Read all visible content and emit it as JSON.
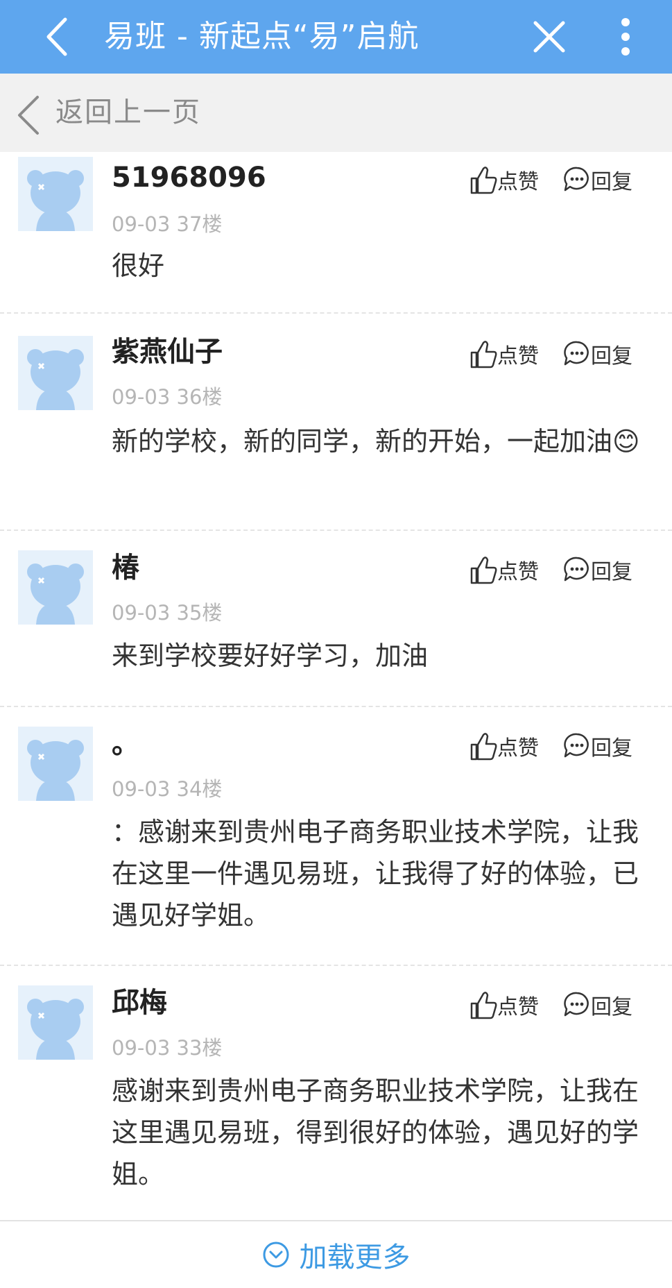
{
  "header": {
    "title": "易班 - 新起点“易”启航",
    "color": "#5ea6ee"
  },
  "subbar": {
    "back_label": "返回上一页"
  },
  "actions": {
    "like_label": "点赞",
    "reply_label": "回复"
  },
  "comments": [
    {
      "name": "51968096",
      "date": "09-03",
      "floor": "37楼",
      "content": "很好"
    },
    {
      "name": "紫燕仙子",
      "date": "09-03",
      "floor": "36楼",
      "content": "新的学校，新的同学，新的开始，一起加油😊"
    },
    {
      "name": "椿",
      "date": "09-03",
      "floor": "35楼",
      "content": "来到学校要好好学习，加油"
    },
    {
      "name": "。",
      "date": "09-03",
      "floor": "34楼",
      "content": "：感谢来到贵州电子商务职业技术学院，让我在这里一件遇见易班，让我得了好的体验，已遇见好学姐。"
    },
    {
      "name": "邱梅",
      "date": "09-03",
      "floor": "33楼",
      "content": "感谢来到贵州电子商务职业技术学院，让我在这里遇见易班，得到很好的体验，遇见好的学姐。"
    }
  ],
  "footer": {
    "load_more_label": "加载更多",
    "accent": "#3d9ae3"
  }
}
